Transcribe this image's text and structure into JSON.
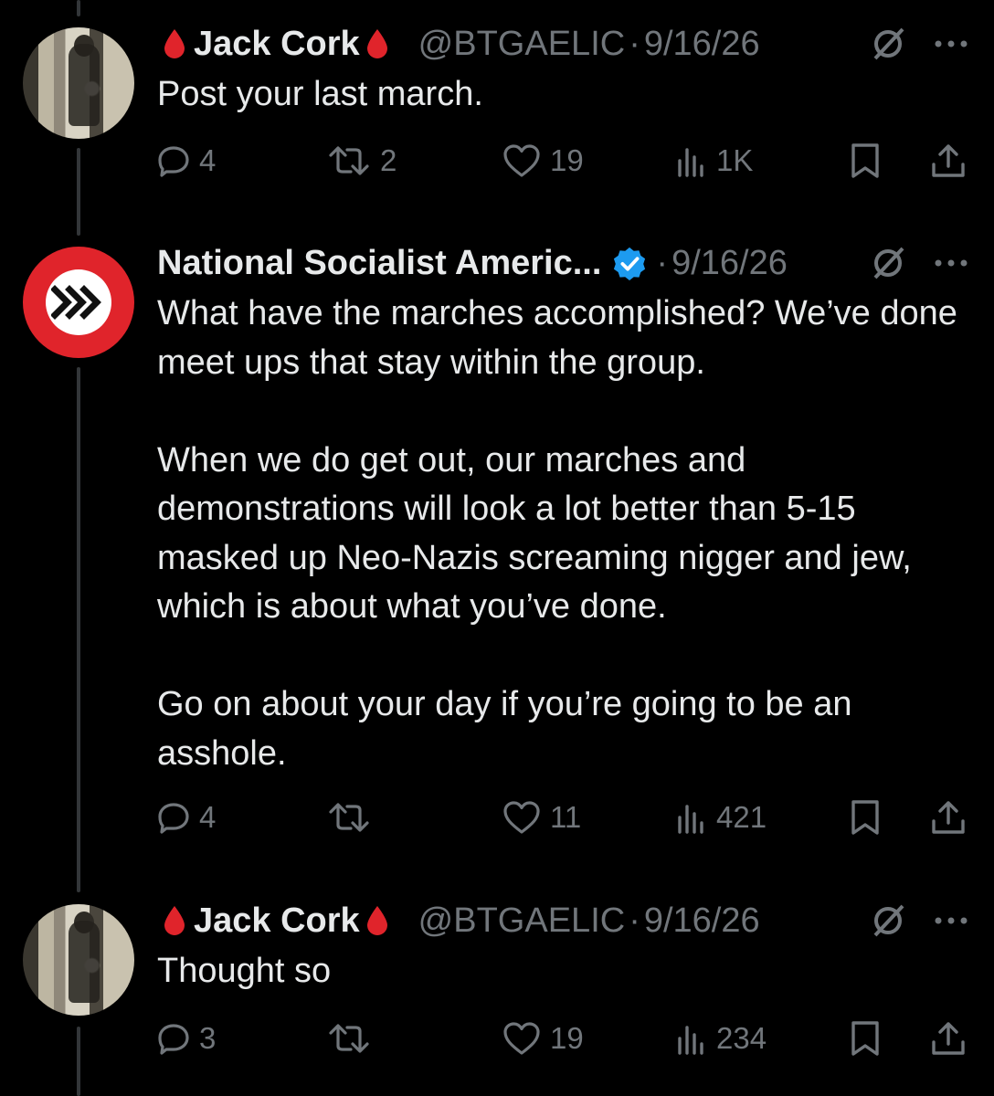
{
  "tweets": [
    {
      "name": "Jack Cork",
      "handle": "@BTGAELIC",
      "separator": "·",
      "date": "9/16/26",
      "text": "Post your last march.",
      "replies": "4",
      "reposts": "2",
      "likes": "19",
      "views": "1K"
    },
    {
      "name": "National Socialist Americ...",
      "verified": true,
      "separator": "·",
      "date": "9/16/26",
      "text": "What have the marches accomplished? We’ve done meet ups that stay within the group.\n\nWhen we do get out, our marches and demonstrations will look a lot better than 5-15 masked up Neo-Nazis screaming nigger and jew, which is about what you’ve done.\n\nGo on about your day if you’re going to be an asshole.",
      "replies": "4",
      "reposts": "",
      "likes": "11",
      "views": "421"
    },
    {
      "name": "Jack Cork",
      "handle": "@BTGAELIC",
      "separator": "·",
      "date": "9/16/26",
      "text": "Thought so",
      "replies": "3",
      "reposts": "",
      "likes": "19",
      "views": "234"
    }
  ],
  "icons": {
    "name_emoji": "drop-of-blood-icon",
    "verified": "verified-badge-icon",
    "grok": "grok-icon",
    "more": "more-icon",
    "reply": "reply-icon",
    "repost": "repost-icon",
    "like": "like-icon",
    "views": "views-icon",
    "bookmark": "bookmark-icon",
    "share": "share-icon"
  },
  "colors": {
    "background": "#000000",
    "text": "#e7e9ea",
    "secondary": "#71767b",
    "verified": "#1d9bf0",
    "drop": "#e0242b",
    "avatar_red": "#e0242b"
  }
}
